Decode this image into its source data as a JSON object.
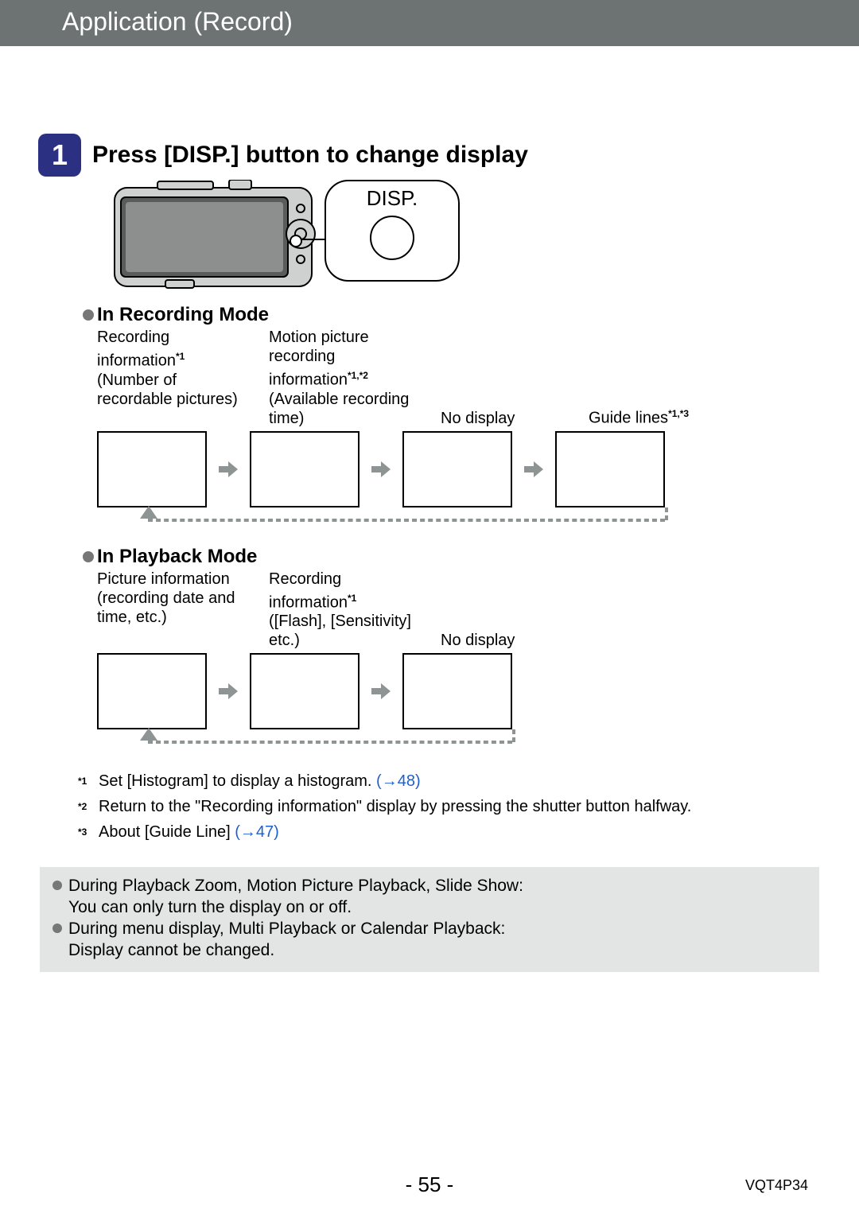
{
  "header": {
    "title": "Application (Record)"
  },
  "step": {
    "number": "1",
    "title": "Press [DISP.] button to change display"
  },
  "disp": {
    "label": "DISP."
  },
  "recording_mode": {
    "heading": "In Recording Mode",
    "captions": {
      "c1a": "Recording information",
      "c1b": "(Number of recordable pictures)",
      "s1": "*1",
      "c2a": "Motion picture recording information",
      "s2a": "*1",
      "s2b": "*2",
      "c2b": "(Available recording time)",
      "c3": "No display",
      "c4": "Guide lines",
      "s4a": "*1",
      "s4b": "*3"
    }
  },
  "playback_mode": {
    "heading": "In Playback Mode",
    "captions": {
      "c1a": "Picture information",
      "c1b": "(recording date and time, etc.)",
      "c2a": "Recording information",
      "s2": "*1",
      "c2b": "([Flash], [Sensitivity] etc.)",
      "c3": "No display"
    }
  },
  "footnotes": {
    "f1_marker": "*1",
    "f1_text": "Set [Histogram] to display a histogram. ",
    "f1_link": "(→48)",
    "f2_marker": "*2",
    "f2_text": "Return to the \"Recording information\" display by pressing the shutter button halfway.",
    "f3_marker": "*3",
    "f3_text": "About [Guide Line] ",
    "f3_link": "(→47)"
  },
  "notice": {
    "n1a": "During Playback Zoom, Motion Picture Playback, Slide Show:",
    "n1b": "You can only turn the display on or off.",
    "n2a": "During menu display, Multi Playback or Calendar Playback:",
    "n2b": "Display cannot be changed."
  },
  "footer": {
    "page": "- 55 -",
    "docid": "VQT4P34"
  }
}
